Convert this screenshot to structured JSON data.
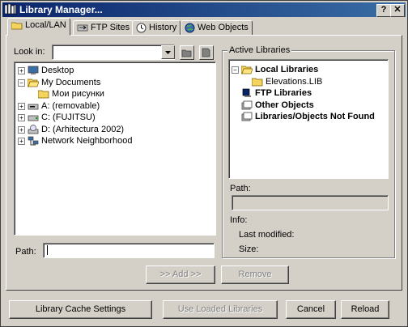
{
  "window": {
    "title": "Library Manager...",
    "help_button": "?",
    "close_button": "✕"
  },
  "tabs": [
    {
      "label": "Local/LAN",
      "icon": "folder-icon",
      "active": true
    },
    {
      "label": "FTP Sites",
      "icon": "ftp-icon",
      "active": false
    },
    {
      "label": "History",
      "icon": "history-icon",
      "active": false
    },
    {
      "label": "Web Objects",
      "icon": "globe-icon",
      "active": false
    }
  ],
  "browser": {
    "look_in_label": "Look in:",
    "look_in_value": "",
    "tree": [
      {
        "label": "Desktop",
        "icon": "desktop-icon",
        "expander": "+",
        "level": 0
      },
      {
        "label": "My Documents",
        "icon": "open-folder-icon",
        "expander": "−",
        "level": 0
      },
      {
        "label": "Мои рисунки",
        "icon": "folder-icon",
        "expander": "",
        "level": 1
      },
      {
        "label": "A: (removable)",
        "icon": "floppy-drive-icon",
        "expander": "+",
        "level": 0
      },
      {
        "label": "C: (FUJITSU)",
        "icon": "hard-drive-icon",
        "expander": "+",
        "level": 0
      },
      {
        "label": "D: (Arhitectura 2002)",
        "icon": "cd-drive-icon",
        "expander": "+",
        "level": 0
      },
      {
        "label": "Network Neighborhood",
        "icon": "network-icon",
        "expander": "+",
        "level": 0
      }
    ],
    "path_label": "Path:",
    "path_value": ""
  },
  "active_libraries": {
    "title": "Active Libraries",
    "tree": [
      {
        "label": "Local Libraries",
        "icon": "open-folder-icon",
        "expander": "−",
        "level": 0,
        "bold": true
      },
      {
        "label": "Elevations.LIB",
        "icon": "folder-icon",
        "expander": "",
        "level": 1,
        "bold": false
      },
      {
        "label": "FTP Libraries",
        "icon": "ftp-library-icon",
        "expander": "",
        "level": 0,
        "bold": true
      },
      {
        "label": "Other Objects",
        "icon": "objects-icon",
        "expander": "",
        "level": 0,
        "bold": true
      },
      {
        "label": "Libraries/Objects Not Found",
        "icon": "missing-icon",
        "expander": "",
        "level": 0,
        "bold": true
      }
    ],
    "path_label": "Path:",
    "path_value": "",
    "info_label": "Info:",
    "last_modified_label": "Last modified:",
    "last_modified_value": "",
    "size_label": "Size:",
    "size_value": ""
  },
  "actions": {
    "add_label": ">> Add >>",
    "remove_label": "Remove"
  },
  "footer": {
    "cache_settings_label": "Library Cache Settings",
    "use_loaded_label": "Use Loaded Libraries",
    "cancel_label": "Cancel",
    "reload_label": "Reload"
  }
}
